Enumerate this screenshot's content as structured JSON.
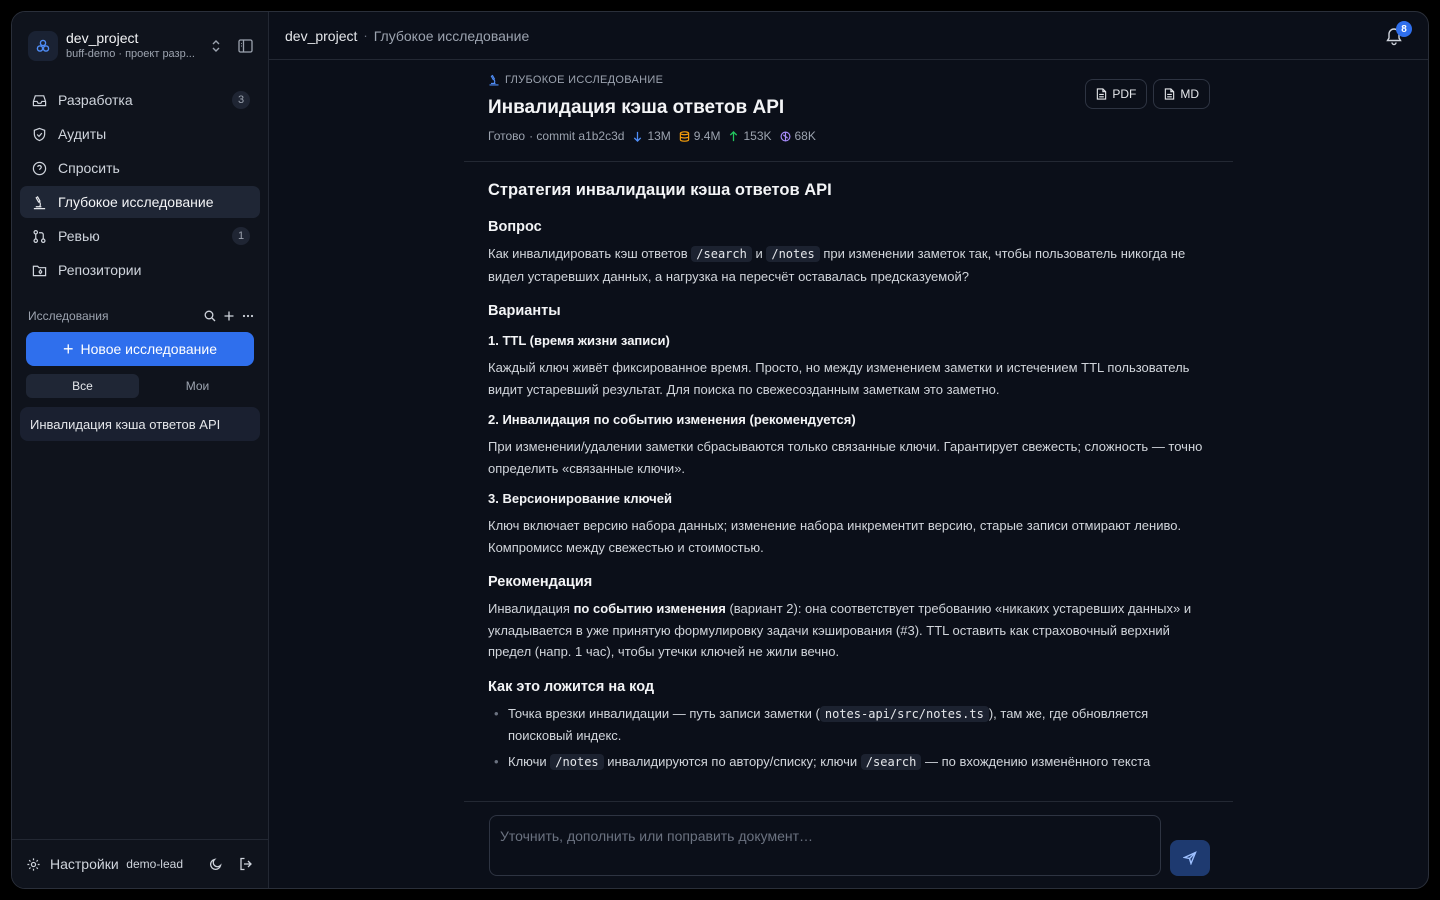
{
  "project": {
    "name": "dev_project",
    "subtitle": "buff-demo · проект разр..."
  },
  "nav": [
    {
      "label": "Разработка",
      "badge": "3",
      "icon": "inbox-icon"
    },
    {
      "label": "Аудиты",
      "badge": "",
      "icon": "shield-icon"
    },
    {
      "label": "Спросить",
      "badge": "",
      "icon": "question-icon"
    },
    {
      "label": "Глубокое исследование",
      "badge": "",
      "icon": "microscope-icon",
      "active": true
    },
    {
      "label": "Ревью",
      "badge": "1",
      "icon": "git-pull-request-icon"
    },
    {
      "label": "Репозитории",
      "badge": "",
      "icon": "folder-git-icon"
    }
  ],
  "research": {
    "section_title": "Исследования",
    "new_button": "Новое исследование",
    "filters": [
      "Все",
      "Мои"
    ],
    "items": [
      "Инвалидация кэша ответов API"
    ]
  },
  "footer": {
    "settings": "Настройки",
    "user": "demo-lead"
  },
  "topbar": {
    "project": "dev_project",
    "separator": "·",
    "page": "Глубокое исследование",
    "notifications": "8"
  },
  "doc": {
    "kicker": "ГЛУБОКОЕ ИССЛЕДОВАНИЕ",
    "title": "Инвалидация кэша ответов API",
    "meta": {
      "status": "Готово",
      "commit": "· commit a1b2c3d",
      "downloads": "13M",
      "storage": "9.4M",
      "uploads": "153K",
      "tokens": "68K"
    },
    "export": {
      "pdf": "PDF",
      "md": "MD"
    },
    "h1": "Стратегия инвалидации кэша ответов API",
    "question_h": "Вопрос",
    "question": {
      "t1": "Как инвалидировать кэш ответов",
      "c1": "/search",
      "t2": "и",
      "c2": "/notes",
      "t3": "при изменении заметок так, чтобы пользователь никогда не видел устаревших данных, а нагрузка на пересчёт оставалась предсказуемой?"
    },
    "variants_h": "Варианты",
    "v1_h": "1. TTL (время жизни записи)",
    "v1": "Каждый ключ живёт фиксированное время. Просто, но между изменением заметки и истечением TTL пользователь видит устаревший результат. Для поиска по свежесозданным заметкам это заметно.",
    "v2_h": "2. Инвалидация по событию изменения (рекомендуется)",
    "v2": "При изменении/удалении заметки сбрасываются только связанные ключи. Гарантирует свежесть; сложность — точно определить «связанные ключи».",
    "v3_h": "3. Версионирование ключей",
    "v3": "Ключ включает версию набора данных; изменение набора инкрементит версию, старые записи отмирают лениво. Компромисс между свежестью и стоимостью.",
    "rec_h": "Рекомендация",
    "rec": {
      "t1": "Инвалидация",
      "b1": "по событию изменения",
      "t2": "(вариант 2): она соответствует требованию «никаких устаревших данных» и укладывается в уже принятую формулировку задачи кэширования (#3). TTL оставить как страховочный верхний предел (напр. 1 час), чтобы утечки ключей не жили вечно."
    },
    "code_h": "Как это ложится на код",
    "li1": {
      "t1": "Точка врезки инвалидации — путь записи заметки (",
      "c1": "notes-api/src/notes.ts",
      "t2": "), там же, где обновляется поисковый индекс."
    },
    "li2": {
      "t1": "Ключи",
      "c1": "/notes",
      "t2": "инвалидируются по автору/списку; ключи",
      "c2": "/search",
      "t3": "— по вхождению изменённого текста"
    }
  },
  "composer": {
    "placeholder": "Уточнить, дополнить или поправить документ…"
  },
  "colors": {
    "accent": "#2f6fed",
    "background": "#0b0f19",
    "sidebar": "#0f131c"
  }
}
